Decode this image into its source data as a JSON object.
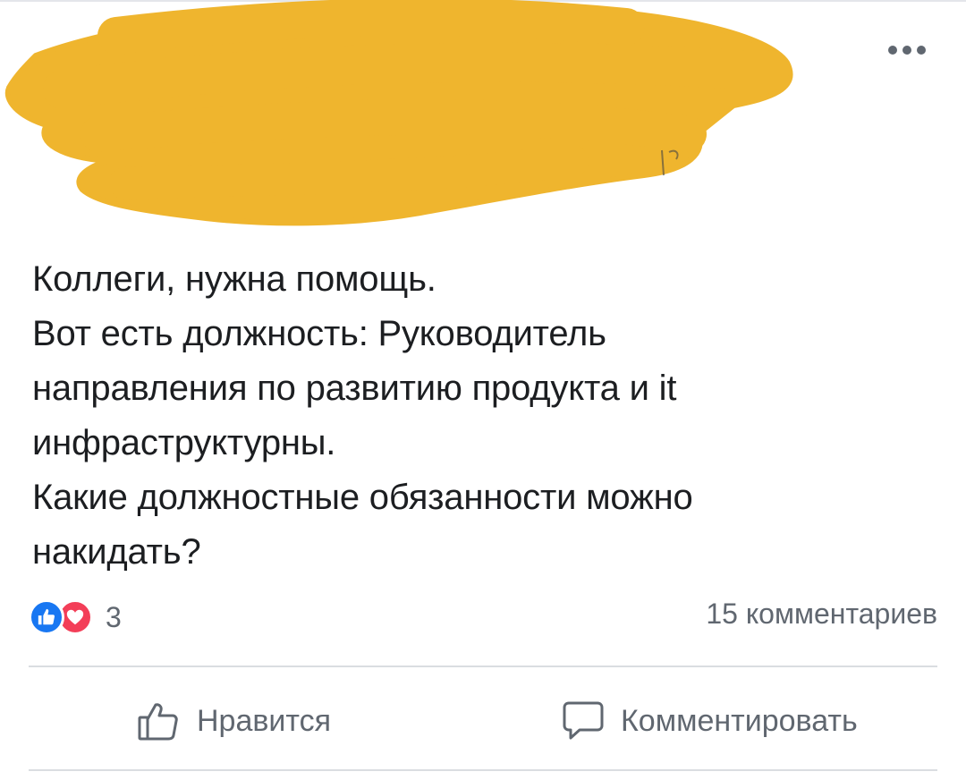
{
  "post": {
    "text_lines": [
      "Коллеги, нужна помощь.",
      "Вот есть должность: Руководитель",
      "направления по развитию продукта и it",
      "инфраструктурны.",
      "Какие должностные обязанности можно",
      "накидать?"
    ]
  },
  "reactions": {
    "count": "3",
    "icons": [
      "thumbs-up-icon",
      "heart-icon"
    ]
  },
  "comments": {
    "count_label": "15 комментариев"
  },
  "actions": {
    "like_label": "Нравится",
    "comment_label": "Комментировать"
  },
  "colors": {
    "censor": "#efb52e",
    "like_blue": "#1877f2",
    "love_red": "#f33e58",
    "text": "#1c1e21",
    "secondary_text": "#606770",
    "divider": "#dadde1"
  }
}
